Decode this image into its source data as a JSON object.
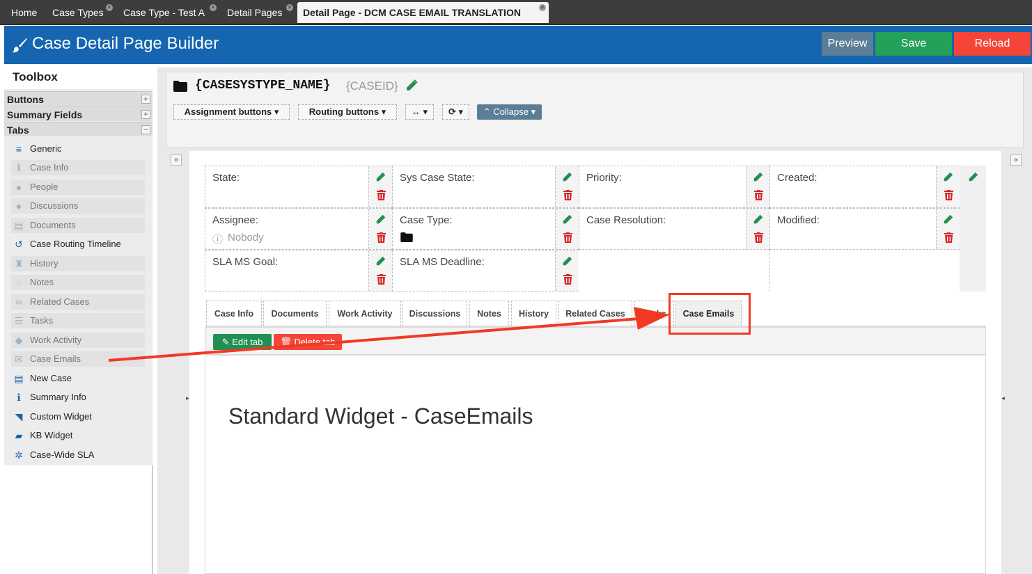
{
  "nav_tabs": [
    {
      "label": "Home",
      "closable": false
    },
    {
      "label": "Case Types",
      "closable": true
    },
    {
      "label": "Case Type - Test A",
      "closable": true
    },
    {
      "label": "Detail Pages",
      "closable": true
    },
    {
      "label": "Detail Page - DCM CASE EMAIL TRANSLATION",
      "closable": true,
      "active": true
    }
  ],
  "header": {
    "title": "Case Detail Page Builder",
    "preview_label": "Preview",
    "save_label": "Save",
    "reload_label": "Reload"
  },
  "toolbox": {
    "title": "Toolbox",
    "sections": [
      {
        "label": "Buttons",
        "toggle": "+"
      },
      {
        "label": "Summary Fields",
        "toggle": "+"
      },
      {
        "label": "Tabs",
        "toggle": "−"
      }
    ],
    "items": [
      {
        "label": "Generic",
        "icon": "database-icon",
        "glyph": "≡",
        "used": false
      },
      {
        "label": "Case Info",
        "icon": "info-icon",
        "glyph": "ℹ",
        "used": true
      },
      {
        "label": "People",
        "icon": "user-icon",
        "glyph": "●",
        "used": true
      },
      {
        "label": "Discussions",
        "icon": "comments-icon",
        "glyph": "●",
        "used": true
      },
      {
        "label": "Documents",
        "icon": "file-icon",
        "glyph": "▤",
        "used": true
      },
      {
        "label": "Case Routing Timeline",
        "icon": "history-icon",
        "glyph": "↺",
        "used": false
      },
      {
        "label": "History",
        "icon": "stamp-icon",
        "glyph": "♜",
        "used": true
      },
      {
        "label": "Notes",
        "icon": "comment-icon",
        "glyph": "◌",
        "used": true
      },
      {
        "label": "Related Cases",
        "icon": "link-icon",
        "glyph": "∞",
        "used": true
      },
      {
        "label": "Tasks",
        "icon": "tasks-icon",
        "glyph": "☰",
        "used": true
      },
      {
        "label": "Work Activity",
        "icon": "cubes-icon",
        "glyph": "◆",
        "used": true
      },
      {
        "label": "Case Emails",
        "icon": "envelope-icon",
        "glyph": "✉",
        "used": true
      },
      {
        "label": "New Case",
        "icon": "list-icon",
        "glyph": "▤",
        "used": false
      },
      {
        "label": "Summary Info",
        "icon": "info-i-icon",
        "glyph": "ℹ",
        "used": false
      },
      {
        "label": "Custom Widget",
        "icon": "tag-icon",
        "glyph": "◥",
        "used": false
      },
      {
        "label": "KB Widget",
        "icon": "book-icon",
        "glyph": "▰",
        "used": false
      },
      {
        "label": "Case-Wide SLA",
        "icon": "cog-icon",
        "glyph": "✲",
        "used": false
      }
    ]
  },
  "case_header": {
    "title": "{CASESYSTYPE_NAME}",
    "case_id": "{CASEID}",
    "assignment_buttons": "Assignment buttons",
    "routing_buttons": "Routing buttons",
    "width_toggle": "↔",
    "refresh_toggle": "⟳",
    "collapse_label": "Collapse"
  },
  "fields": [
    {
      "label": "State:",
      "value": ""
    },
    {
      "label": "Sys Case State:",
      "value": ""
    },
    {
      "label": "Priority:",
      "value": ""
    },
    {
      "label": "Created:",
      "value": ""
    },
    {
      "label": "Assignee:",
      "value": "Nobody"
    },
    {
      "label": "Case Type:",
      "value": ""
    },
    {
      "label": "Case Resolution:",
      "value": ""
    },
    {
      "label": "Modified:",
      "value": ""
    },
    {
      "label": "SLA MS Goal:",
      "value": ""
    },
    {
      "label": "SLA MS Deadline:",
      "value": ""
    }
  ],
  "content_tabs": [
    {
      "label": "Case Info"
    },
    {
      "label": "Documents"
    },
    {
      "label": "Work Activity"
    },
    {
      "label": "Discussions"
    },
    {
      "label": "Notes"
    },
    {
      "label": "History"
    },
    {
      "label": "Related Cases"
    },
    {
      "label": "Tasks"
    },
    {
      "label": "Case Emails",
      "active": true
    }
  ],
  "tab_actions": {
    "edit_label": "Edit tab",
    "delete_label": "Delete tab"
  },
  "widget": {
    "title": "Standard Widget - CaseEmails"
  },
  "colors": {
    "header_blue": "#1565b0",
    "save_green": "#23a05a",
    "reload_red": "#f44538",
    "preview_gray": "#5c7d96",
    "edit_green": "#218f52",
    "trash_red": "#d62828",
    "annotation_red": "#f03a24"
  }
}
